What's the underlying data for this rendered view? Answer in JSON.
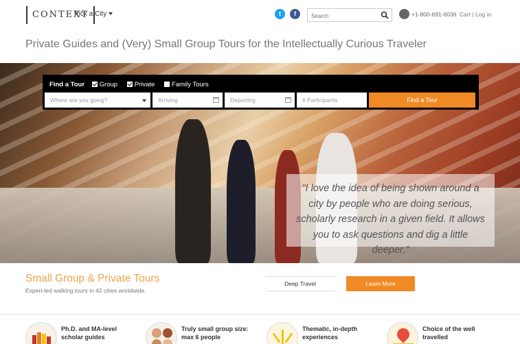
{
  "header": {
    "logo": "CONTEXT",
    "city_picker": "Pick a City",
    "social": {
      "twitter": "twitter-icon",
      "facebook": "facebook-icon"
    },
    "search": {
      "placeholder": "Search"
    },
    "phone": "+1-800-691-6036",
    "cart": "Cart",
    "separator": "|",
    "login": "Log in"
  },
  "tagline": "Private Guides and (Very) Small Group Tours for the Intellectually Curious Traveler",
  "finder": {
    "title": "Find a Tour",
    "options": [
      {
        "label": "Group",
        "checked": true
      },
      {
        "label": "Private",
        "checked": true
      },
      {
        "label": "Family Tours",
        "checked": false
      }
    ],
    "destination_placeholder": "Where are you going?",
    "arriving_placeholder": "Arriving",
    "departing_placeholder": "Departing",
    "participants_placeholder": "# Participants",
    "button": "Find a Tour"
  },
  "quote": "\"I love the idea of being shown around a city by people who are doing serious, scholarly research in a given field. It allows you to ask questions and dig a little deeper.\"",
  "section": {
    "title": "Small Group & Private Tours",
    "subtitle": "Expert-led walking tours in 42 cities worldwide.",
    "deep_travel": "Deep Travel",
    "learn_more": "Learn More"
  },
  "features": [
    {
      "text": "Ph.D. and MA-level scholar guides"
    },
    {
      "text": "Truly small group size: max 6 people"
    },
    {
      "text": "Thematic, in-depth experiences"
    },
    {
      "text": "Choice of the well travelled"
    }
  ],
  "colors": {
    "accent": "#f08a24",
    "title_orange": "#f0a34a"
  }
}
